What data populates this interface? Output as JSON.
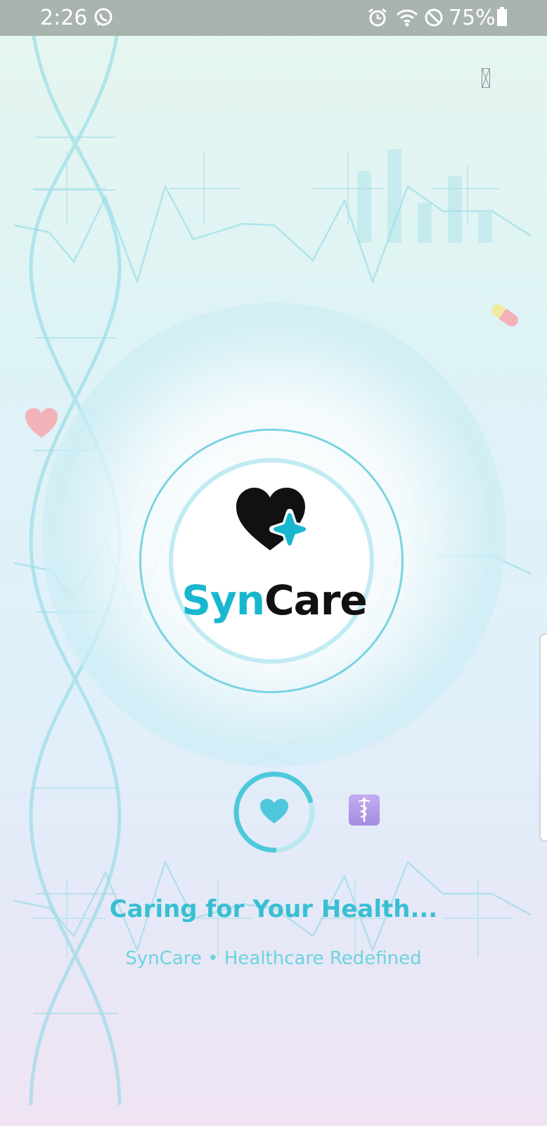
{
  "status_bar": {
    "time": "2:26",
    "battery_text": "75%",
    "icons": [
      "whatsapp-icon",
      "alarm-icon",
      "wifi-icon",
      "do-not-disturb-icon",
      "battery-icon"
    ]
  },
  "splash": {
    "brand_syn": "Syn",
    "brand_care": "Care",
    "tagline": "Caring for Your Health...",
    "subtitle": "SynCare • Healthcare Redefined",
    "progress_fraction": 0.7
  },
  "colors": {
    "brand_cyan": "#18b7cf",
    "brand_dark": "#111111",
    "tagline": "#38bfd3",
    "subtitle": "#6dd3e0",
    "status_bar": "#a9b4ae"
  },
  "icons": {
    "close": "close-icon",
    "pill": "pill-icon",
    "heart": "heart-icon",
    "caduceus": "caduceus-icon"
  }
}
